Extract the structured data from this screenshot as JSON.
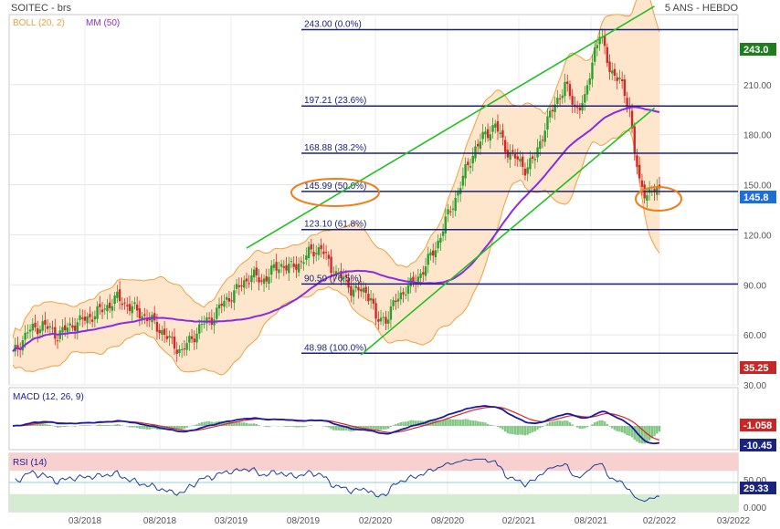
{
  "header": {
    "title": "SOITEC - brs",
    "period": "5 ANS - HEBDO",
    "legend_boll": "BOLL (20, 2)",
    "legend_mm": "MM (50)"
  },
  "colors": {
    "boll": "#f0a040",
    "boll_fill": "#fde6cc",
    "mm": "#8a2be2",
    "up": "#2ca02c",
    "down": "#d62728",
    "fib": "#1a237e",
    "channel": "#22c022",
    "highlight": "#ef7d1a",
    "macd": "#1a1aa0",
    "signal": "#d62728",
    "hist": "#4caf50",
    "rsi": "#1a3fa0"
  },
  "chart_data": [
    {
      "type": "candlestick",
      "name": "price",
      "x_labels": [
        "03/2018",
        "08/2018",
        "03/2019",
        "08/2019",
        "02/2020",
        "08/2020",
        "02/2021",
        "08/2021",
        "02/2022",
        "03/2022"
      ],
      "y_ticks": [
        30,
        60,
        90,
        120,
        150,
        180,
        210
      ],
      "ylim": [
        30,
        252
      ],
      "last_price_label": "145.8",
      "high_label": "243.0",
      "low_label": "35.25",
      "y_tick_labels": [
        "30.00",
        "60.00",
        "90.00",
        "120.00",
        "150.00",
        "180.00",
        "210.00"
      ],
      "fibonacci": [
        {
          "label": "243.00  (0.0%)",
          "value": 243.0
        },
        {
          "label": "197.21  (23.6%)",
          "value": 197.21
        },
        {
          "label": "168.88  (38.2%)",
          "value": 168.88
        },
        {
          "label": "145.99  (50.0%)",
          "value": 145.99
        },
        {
          "label": "123.10  (61.8%)",
          "value": 123.1
        },
        {
          "label": "90.50  (76.5%)",
          "value": 90.5
        },
        {
          "label": "48.98  (100.0%)",
          "value": 48.98
        }
      ],
      "close_path": [
        [
          0,
          48
        ],
        [
          6,
          62
        ],
        [
          12,
          66
        ],
        [
          18,
          60
        ],
        [
          24,
          66
        ],
        [
          30,
          70
        ],
        [
          36,
          75
        ],
        [
          42,
          82
        ],
        [
          46,
          78
        ],
        [
          52,
          72
        ],
        [
          56,
          68
        ],
        [
          60,
          62
        ],
        [
          64,
          55
        ],
        [
          68,
          50
        ],
        [
          72,
          58
        ],
        [
          76,
          66
        ],
        [
          80,
          70
        ],
        [
          84,
          78
        ],
        [
          88,
          84
        ],
        [
          92,
          90
        ],
        [
          96,
          96
        ],
        [
          100,
          92
        ],
        [
          104,
          98
        ],
        [
          108,
          102
        ],
        [
          112,
          100
        ],
        [
          116,
          104
        ],
        [
          120,
          110
        ],
        [
          124,
          112
        ],
        [
          128,
          100
        ],
        [
          132,
          95
        ],
        [
          136,
          88
        ],
        [
          140,
          86
        ],
        [
          144,
          84
        ],
        [
          146,
          68
        ],
        [
          150,
          70
        ],
        [
          154,
          80
        ],
        [
          158,
          88
        ],
        [
          162,
          92
        ],
        [
          166,
          102
        ],
        [
          170,
          112
        ],
        [
          174,
          128
        ],
        [
          178,
          142
        ],
        [
          182,
          158
        ],
        [
          186,
          172
        ],
        [
          190,
          180
        ],
        [
          194,
          186
        ],
        [
          198,
          172
        ],
        [
          202,
          166
        ],
        [
          206,
          160
        ],
        [
          210,
          166
        ],
        [
          214,
          185
        ],
        [
          218,
          198
        ],
        [
          222,
          210
        ],
        [
          226,
          196
        ],
        [
          230,
          200
        ],
        [
          234,
          232
        ],
        [
          236,
          240
        ],
        [
          240,
          220
        ],
        [
          244,
          212
        ],
        [
          248,
          196
        ],
        [
          250,
          170
        ],
        [
          252,
          150
        ],
        [
          254,
          145.8
        ]
      ],
      "channel_lines": [
        {
          "from": [
            94,
            112
          ],
          "to": [
            258,
            257
          ]
        },
        {
          "from": [
            140,
            48
          ],
          "to": [
            258,
            196
          ]
        }
      ]
    },
    {
      "type": "line",
      "name": "MACD (12, 26, 9)",
      "values_labels": [
        "-1.058",
        "-10.45"
      ]
    },
    {
      "type": "line",
      "name": "RSI (14)",
      "values_labels": [
        "50.00",
        "29.33",
        "0.000"
      ]
    }
  ],
  "macd_panel": {
    "label": "MACD (12, 26, 9)",
    "macd_value": "-10.45",
    "signal_value": "-1.058"
  },
  "rsi_panel": {
    "label": "RSI (14)",
    "value": "29.33",
    "tick_50": "50.00",
    "tick_0": "0.000"
  }
}
